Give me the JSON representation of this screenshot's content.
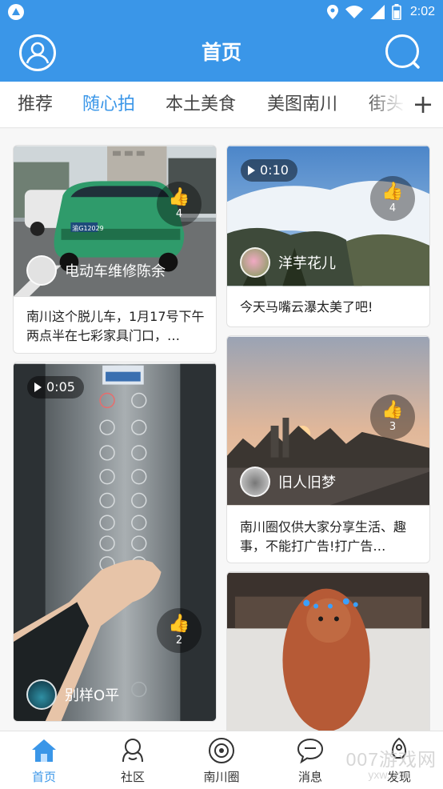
{
  "status_bar": {
    "time": "2:02"
  },
  "app_bar": {
    "title": "首页"
  },
  "tabs": [
    {
      "label": "推荐",
      "active": false
    },
    {
      "label": "随心拍",
      "active": true
    },
    {
      "label": "本土美食",
      "active": false
    },
    {
      "label": "美图南川",
      "active": false
    },
    {
      "label": "街头",
      "active": false
    }
  ],
  "feed": {
    "left": [
      {
        "author": "电动车维修陈余",
        "likes": "4",
        "caption": "南川这个脱儿车，1月17号下午两点半在七彩家具门口，…",
        "plate": "渝G12029"
      },
      {
        "author": "别样O平",
        "likes": "2",
        "duration": "0:05"
      }
    ],
    "right": [
      {
        "author": "洋芋花儿",
        "likes": "4",
        "caption": "今天马嘴云瀑太美了吧!",
        "duration": "0:10"
      },
      {
        "author": "旧人旧梦",
        "likes": "3",
        "caption": "南川圈仅供大家分享生活、趣事，不能打广告!打广告…"
      },
      {
        "author": "",
        "likes": ""
      }
    ]
  },
  "bottom_nav": [
    {
      "label": "首页",
      "active": true
    },
    {
      "label": "社区",
      "active": false
    },
    {
      "label": "南川圈",
      "active": false
    },
    {
      "label": "消息",
      "active": false
    },
    {
      "label": "发现",
      "active": false
    }
  ],
  "watermark": {
    "text": "007游戏网",
    "sub": "yxw.com"
  },
  "colors": {
    "accent": "#3a96e8",
    "text": "#222222"
  }
}
